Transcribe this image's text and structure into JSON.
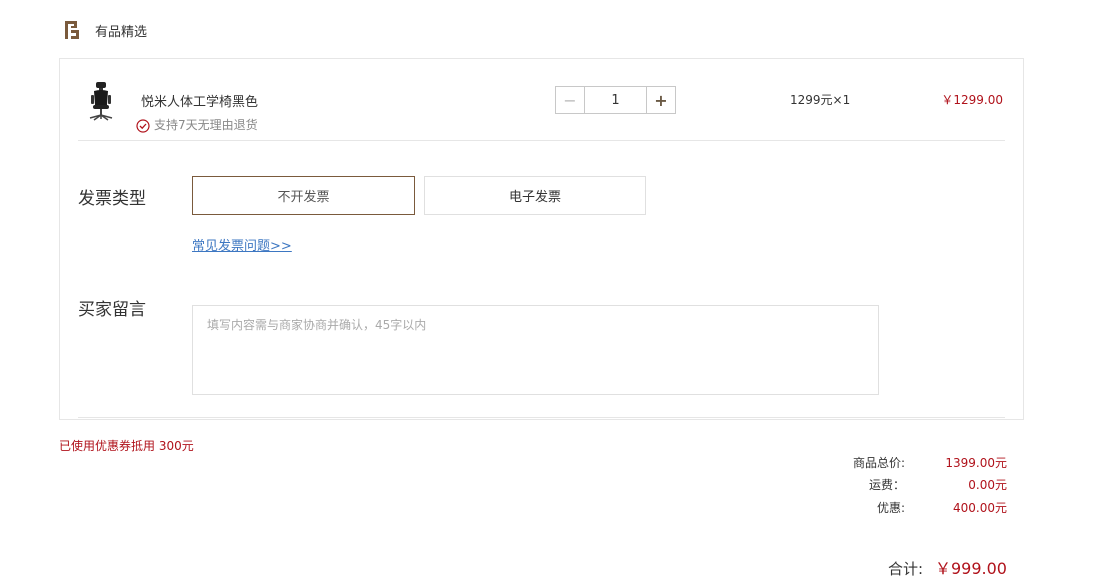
{
  "store": {
    "name": "有品精选",
    "brand_color": "#7a5a3c"
  },
  "item": {
    "name": "悦米人体工学椅黑色",
    "return_policy": "支持7天无理由退货",
    "quantity": "1",
    "minus_symbol": "−",
    "plus_symbol": "+",
    "unit_price_text": "1299元×1",
    "line_total": "￥1299.00"
  },
  "invoice": {
    "label": "发票类型",
    "options": [
      "不开发票",
      "电子发票"
    ],
    "selected": "不开发票",
    "faq_link": "常见发票问题>>"
  },
  "message": {
    "label": "买家留言",
    "placeholder": "填写内容需与商家协商并确认，45字以内",
    "value": ""
  },
  "coupon_note": "已使用优惠券抵用 300元",
  "summary": {
    "subtotal_label": "商品总价:",
    "subtotal_value": "1399.00元",
    "shipping_label": "运费：",
    "shipping_value": "0.00元",
    "discount_label": "优惠:",
    "discount_value": "400.00元",
    "total_label": "合计:",
    "total_value": "￥999.00"
  },
  "colors": {
    "price_red": "#b0121b",
    "link_blue": "#3d77c2",
    "border": "#e6e6e6"
  }
}
